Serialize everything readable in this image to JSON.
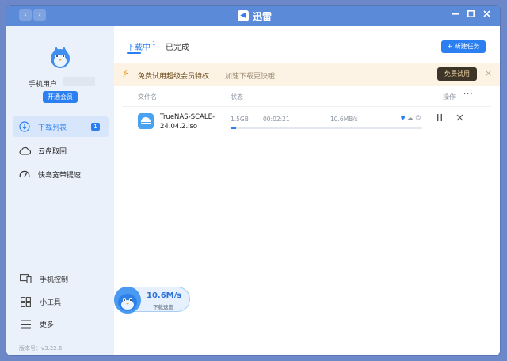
{
  "window": {
    "title": "迅雷",
    "back_icon": "chevron-left-icon",
    "forward_icon": "chevron-right-icon"
  },
  "sidebar": {
    "user": {
      "name": "手机用户"
    },
    "vip_button": "开通会员",
    "items": [
      {
        "label": "下载列表",
        "badge": "1",
        "active": true,
        "icon": "download-icon"
      },
      {
        "label": "云盘取回",
        "icon": "cloud-icon"
      },
      {
        "label": "快鸟宽带提速",
        "icon": "speedometer-icon"
      }
    ],
    "bottom": [
      {
        "label": "手机控制",
        "icon": "devices-icon"
      },
      {
        "label": "小工具",
        "icon": "grid-icon"
      },
      {
        "label": "更多",
        "icon": "menu-icon"
      }
    ],
    "version": "版本号：v3.22.6"
  },
  "main": {
    "tabs": [
      {
        "label": "下载中",
        "count": "1",
        "active": true
      },
      {
        "label": "已完成"
      }
    ],
    "new_task_label": "新建任务",
    "promo": {
      "title": "免费试用超级会员特权",
      "subtitle": "加速下载更快哦",
      "button": "免费试用",
      "accent": "#f0a030"
    },
    "columns": {
      "file": "文件名",
      "status": "状态",
      "action": "操作",
      "more": "···"
    },
    "downloads": [
      {
        "name": "TrueNAS-SCALE-24.04.2.iso",
        "size": "1.5GB",
        "time": "00:02:21",
        "speed": "10.6MB/s",
        "progress": 0.03
      }
    ]
  },
  "speed_widget": {
    "value": "10.6M/s",
    "label": "下载速度"
  },
  "colors": {
    "accent": "#2b7ff0",
    "titlebar": "#5b8ad8",
    "sidebar_bg": "#eaf1fb"
  }
}
